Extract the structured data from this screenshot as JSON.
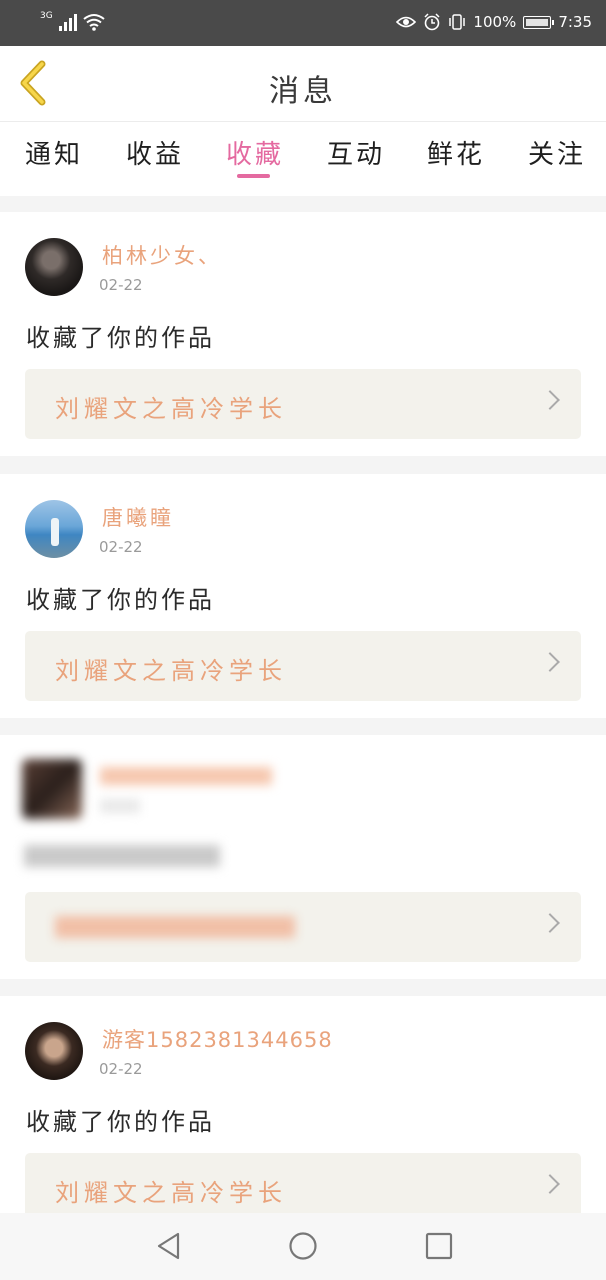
{
  "status_bar": {
    "network": "3G",
    "battery": "100%",
    "time": "7:35"
  },
  "header": {
    "title": "消息"
  },
  "tabs": [
    {
      "label": "通知"
    },
    {
      "label": "收益"
    },
    {
      "label": "收藏",
      "active": true
    },
    {
      "label": "互动"
    },
    {
      "label": "鲜花"
    },
    {
      "label": "关注"
    }
  ],
  "accent_color": "#e46aa0",
  "name_color": "#e9a37c",
  "items": [
    {
      "username": "柏林少女、",
      "date": "02-22",
      "action": "收藏了你的作品",
      "work_title": "刘耀文之高冷学长"
    },
    {
      "username": "唐曦瞳",
      "date": "02-22",
      "action": "收藏了你的作品",
      "work_title": "刘耀文之高冷学长"
    },
    {
      "username": "",
      "date": "",
      "action": "",
      "work_title": ""
    },
    {
      "username": "游客15823813446​58",
      "date": "02-22",
      "action": "收藏了你的作品",
      "work_title": "刘耀文之高冷学长"
    }
  ],
  "nav": {
    "back_icon": "triangle-back",
    "home_icon": "circle-home",
    "recents_icon": "square-recents"
  }
}
